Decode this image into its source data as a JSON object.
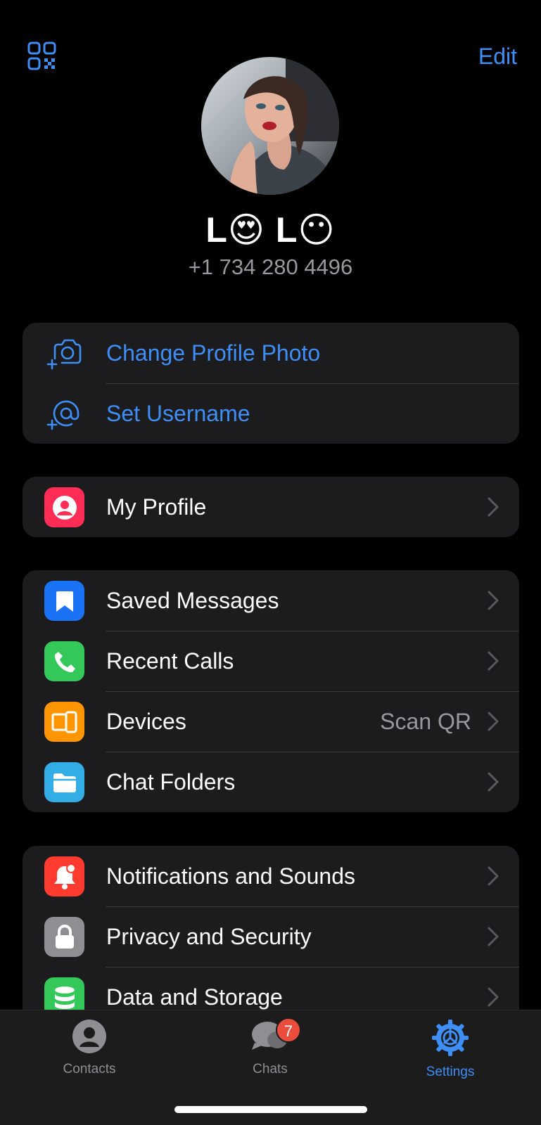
{
  "header": {
    "edit_label": "Edit",
    "qr_icon": "qr-code-icon"
  },
  "profile": {
    "name": "L😍 L😶",
    "phone": "+1 734 280 4496"
  },
  "account_actions": [
    {
      "label": "Change Profile Photo",
      "icon": "camera-add-icon"
    },
    {
      "label": "Set Username",
      "icon": "at-add-icon"
    }
  ],
  "profile_group": [
    {
      "label": "My Profile",
      "icon": "person-icon",
      "color": "#ff2d55"
    }
  ],
  "main_group": [
    {
      "label": "Saved Messages",
      "icon": "bookmark-icon",
      "color": "#1a73f5"
    },
    {
      "label": "Recent Calls",
      "icon": "phone-icon",
      "color": "#34c759"
    },
    {
      "label": "Devices",
      "value": "Scan QR",
      "icon": "devices-icon",
      "color": "#ff9500"
    },
    {
      "label": "Chat Folders",
      "icon": "folder-icon",
      "color": "#32ade6"
    }
  ],
  "settings_group": [
    {
      "label": "Notifications and Sounds",
      "icon": "bell-icon",
      "color": "#ff3b30"
    },
    {
      "label": "Privacy and Security",
      "icon": "lock-icon",
      "color": "#8e8e93"
    },
    {
      "label": "Data and Storage",
      "icon": "database-icon",
      "color": "#34c759"
    }
  ],
  "tabbar": {
    "contacts": "Contacts",
    "chats": "Chats",
    "chats_badge": "7",
    "settings": "Settings",
    "accent": "#3e8ef7"
  }
}
